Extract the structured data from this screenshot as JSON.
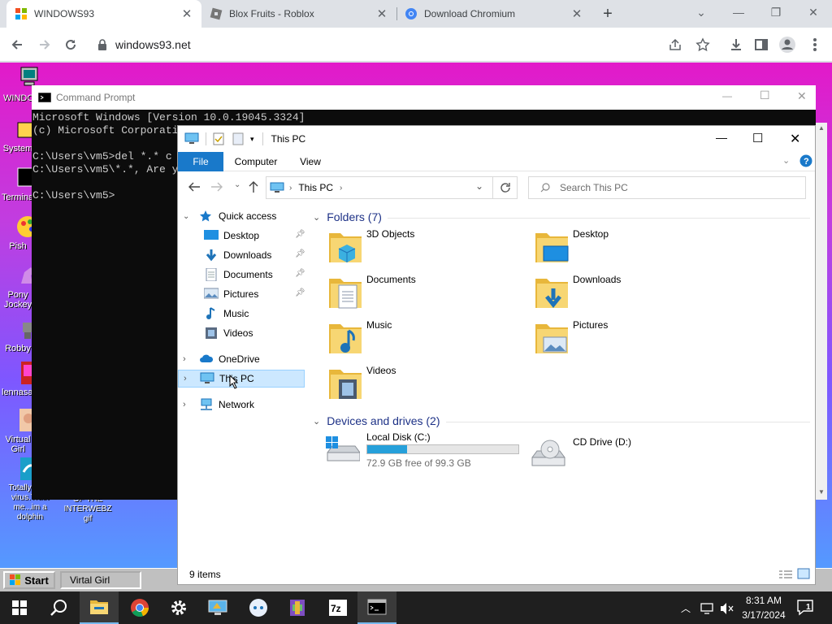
{
  "browser": {
    "tabs": [
      {
        "label": "WINDOWS93",
        "icon": "windows93-favicon"
      },
      {
        "label": "Blox Fruits - Roblox",
        "icon": "roblox-favicon"
      },
      {
        "label": "Download Chromium",
        "icon": "chromium-favicon"
      }
    ],
    "url": "windows93.net"
  },
  "desktop": {
    "icons": [
      "WINDOWS93",
      "System",
      "Terminal",
      "Pish",
      "Pony Jockey",
      "Robby",
      "lennasaurus",
      "Virtual Girl",
      "Totally not a virus.Trust me...im a dolphin",
      "OF THE INTERWEBZ gif"
    ]
  },
  "cmd": {
    "title": "Command Prompt",
    "lines": [
      "Microsoft Windows [Version 10.0.19045.3324]",
      "(c) Microsoft Corporati",
      "",
      "C:\\Users\\vm5>del *.* c",
      "C:\\Users\\vm5\\*.*, Are y",
      "",
      "C:\\Users\\vm5>"
    ]
  },
  "explorer": {
    "title": "This PC",
    "ribbon": {
      "file": "File",
      "computer": "Computer",
      "view": "View"
    },
    "address": "This PC",
    "search_placeholder": "Search This PC",
    "nav": {
      "quick_access": "Quick access",
      "items": [
        "Desktop",
        "Downloads",
        "Documents",
        "Pictures",
        "Music",
        "Videos"
      ],
      "onedrive": "OneDrive",
      "thispc": "This PC",
      "network": "Network"
    },
    "folders_header": "Folders (7)",
    "folders": [
      "3D Objects",
      "Desktop",
      "Documents",
      "Downloads",
      "Music",
      "Pictures",
      "Videos"
    ],
    "devices_header": "Devices and drives (2)",
    "drives": [
      {
        "name": "Local Disk (C:)",
        "free": "72.9 GB free of 99.3 GB",
        "used_fraction": 0.266
      },
      {
        "name": "CD Drive (D:)"
      }
    ],
    "status": "9 items"
  },
  "w93taskbar": {
    "start": "Start",
    "task": "Virtal Girl"
  },
  "taskbar": {
    "time": "8:31 AM",
    "date": "3/17/2024",
    "notifications": "1"
  }
}
